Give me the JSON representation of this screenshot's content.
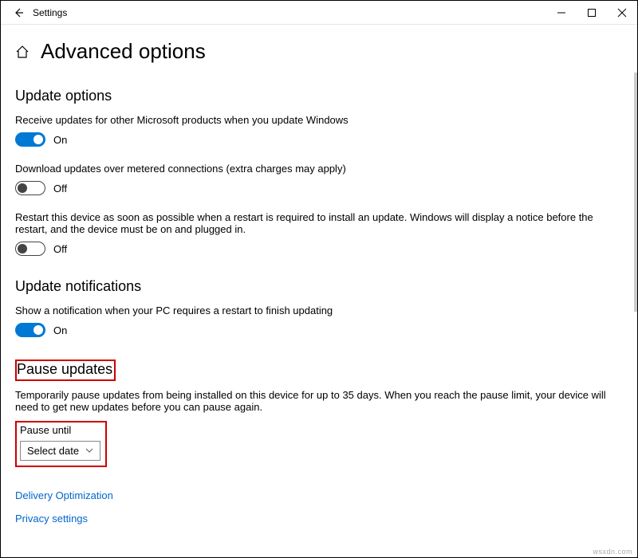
{
  "window": {
    "title": "Settings"
  },
  "page": {
    "title": "Advanced options"
  },
  "sections": {
    "update_options": {
      "heading": "Update options",
      "receive_ms": {
        "label": "Receive updates for other Microsoft products when you update Windows",
        "state": "On"
      },
      "metered": {
        "label": "Download updates over metered connections (extra charges may apply)",
        "state": "Off"
      },
      "restart": {
        "label": "Restart this device as soon as possible when a restart is required to install an update. Windows will display a notice before the restart, and the device must be on and plugged in.",
        "state": "Off"
      }
    },
    "update_notifications": {
      "heading": "Update notifications",
      "notify": {
        "label": "Show a notification when your PC requires a restart to finish updating",
        "state": "On"
      }
    },
    "pause_updates": {
      "heading": "Pause updates",
      "description": "Temporarily pause updates from being installed on this device for up to 35 days. When you reach the pause limit, your device will need to get new updates before you can pause again.",
      "pause_until_label": "Pause until",
      "select_date": "Select date"
    }
  },
  "links": {
    "delivery_optimization": "Delivery Optimization",
    "privacy_settings": "Privacy settings"
  },
  "watermark": "wsxdn.com"
}
